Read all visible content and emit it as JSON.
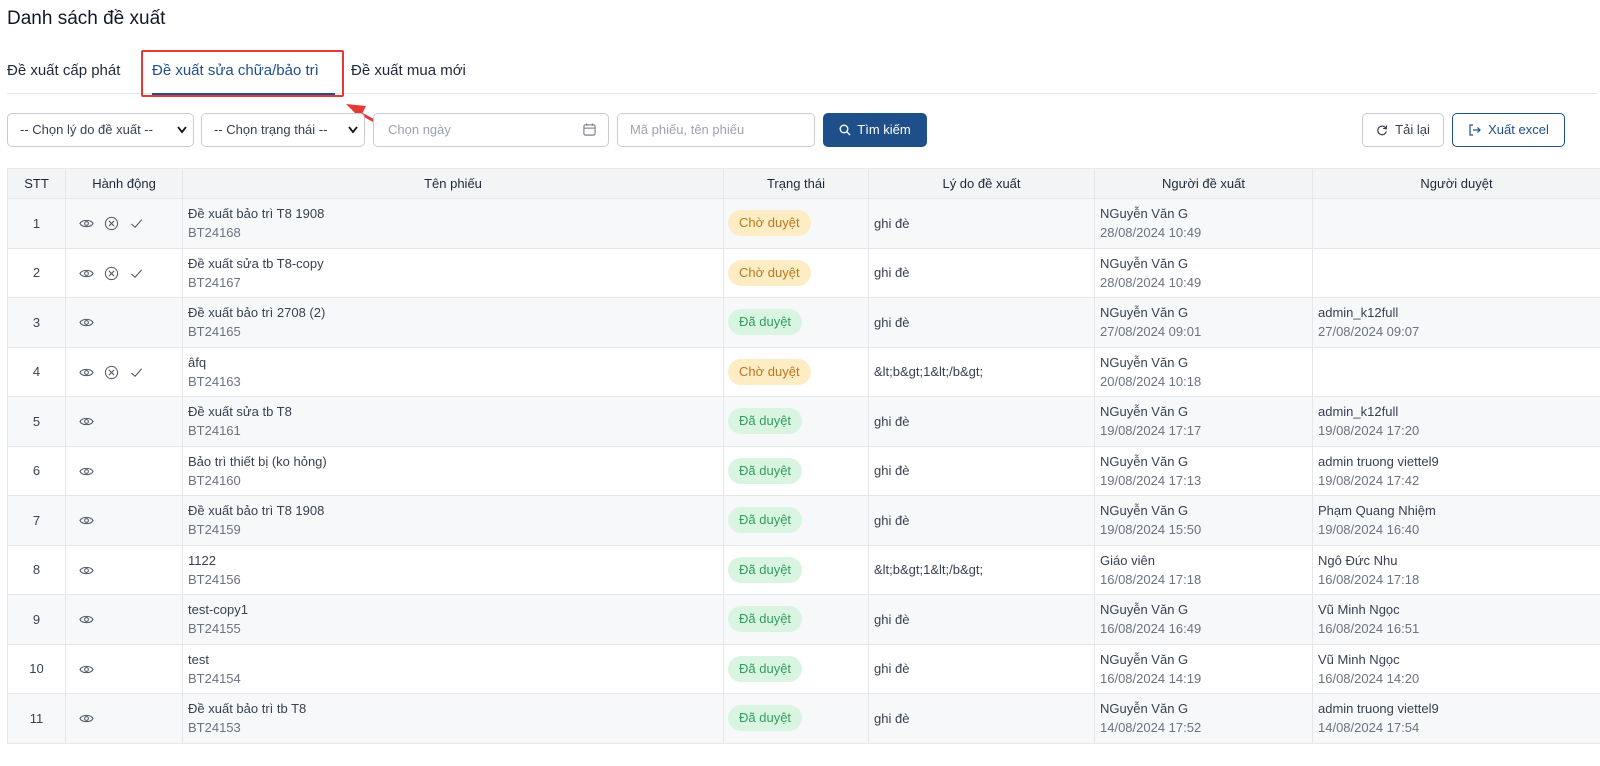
{
  "page": {
    "title": "Danh sách đề xuất"
  },
  "tabs": [
    {
      "label": "Đề xuất cấp phát"
    },
    {
      "label": "Đề xuất sửa chữa/bảo trì"
    },
    {
      "label": "Đề xuất mua mới"
    }
  ],
  "active_tab": "Đề xuất sửa chữa/bảo trì",
  "filters": {
    "reason_select": "-- Chọn lý do đề xuất --",
    "status_select": "-- Chọn trạng thái --",
    "date_placeholder": "Chọn ngày",
    "search_placeholder": "Mã phiếu, tên phiếu",
    "search_button": "Tìm kiếm",
    "reload_button": "Tải lại",
    "export_button": "Xuất excel"
  },
  "table": {
    "headers": [
      "STT",
      "Hành động",
      "Tên phiếu",
      "Trạng thái",
      "Lý do đề xuất",
      "Người đề xuất",
      "Người duyệt"
    ],
    "rows": [
      {
        "stt": "1",
        "name": "Đề xuất bảo trì T8 1908",
        "code": "BT24168",
        "status": "Chờ duyệt",
        "reason": "ghi đè",
        "proposer": "NGuyễn Văn G",
        "proposed_at": "28/08/2024 10:49",
        "approver": "",
        "approved_at": ""
      },
      {
        "stt": "2",
        "name": "Đề xuất sửa tb T8-copy",
        "code": "BT24167",
        "status": "Chờ duyệt",
        "reason": "ghi đè",
        "proposer": "NGuyễn Văn G",
        "proposed_at": "28/08/2024 10:49",
        "approver": "",
        "approved_at": ""
      },
      {
        "stt": "3",
        "name": "Đề xuất bảo trì 2708 (2)",
        "code": "BT24165",
        "status": "Đã duyệt",
        "reason": "ghi đè",
        "proposer": "NGuyễn Văn G",
        "proposed_at": "27/08/2024 09:01",
        "approver": "admin_k12full",
        "approved_at": "27/08/2024 09:07"
      },
      {
        "stt": "4",
        "name": "âfq",
        "code": "BT24163",
        "status": "Chờ duyệt",
        "reason": "&lt;b&gt;1&lt;/b&gt;",
        "proposer": "NGuyễn Văn G",
        "proposed_at": "20/08/2024 10:18",
        "approver": "",
        "approved_at": ""
      },
      {
        "stt": "5",
        "name": "Đề xuất sửa tb T8",
        "code": "BT24161",
        "status": "Đã duyệt",
        "reason": "ghi đè",
        "proposer": "NGuyễn Văn G",
        "proposed_at": "19/08/2024 17:17",
        "approver": "admin_k12full",
        "approved_at": "19/08/2024 17:20"
      },
      {
        "stt": "6",
        "name": "Bảo trì thiết bị (ko hỏng)",
        "code": "BT24160",
        "status": "Đã duyệt",
        "reason": "ghi đè",
        "proposer": "NGuyễn Văn G",
        "proposed_at": "19/08/2024 17:13",
        "approver": "admin truong viettel9",
        "approved_at": "19/08/2024 17:42"
      },
      {
        "stt": "7",
        "name": "Đề xuất bảo trì T8 1908",
        "code": "BT24159",
        "status": "Đã duyệt",
        "reason": "ghi đè",
        "proposer": "NGuyễn Văn G",
        "proposed_at": "19/08/2024 15:50",
        "approver": "Phạm Quang Nhiệm",
        "approved_at": "19/08/2024 16:40"
      },
      {
        "stt": "8",
        "name": "1122",
        "code": "BT24156",
        "status": "Đã duyệt",
        "reason": "&lt;b&gt;1&lt;/b&gt;",
        "proposer": "Giáo viên",
        "proposed_at": "16/08/2024 17:18",
        "approver": "Ngô Đức Nhu",
        "approved_at": "16/08/2024 17:18"
      },
      {
        "stt": "9",
        "name": "test-copy1",
        "code": "BT24155",
        "status": "Đã duyệt",
        "reason": "ghi đè",
        "proposer": "NGuyễn Văn G",
        "proposed_at": "16/08/2024 16:49",
        "approver": "Vũ Minh Ngọc",
        "approved_at": "16/08/2024 16:51"
      },
      {
        "stt": "10",
        "name": "test",
        "code": "BT24154",
        "status": "Đã duyệt",
        "reason": "ghi đè",
        "proposer": "NGuyễn Văn G",
        "proposed_at": "16/08/2024 14:19",
        "approver": "Vũ Minh Ngọc",
        "approved_at": "16/08/2024 14:20"
      },
      {
        "stt": "11",
        "name": "Đề xuất bảo trì tb T8",
        "code": "BT24153",
        "status": "Đã duyệt",
        "reason": "ghi đè",
        "proposer": "NGuyễn Văn G",
        "proposed_at": "14/08/2024 17:52",
        "approver": "admin truong viettel9",
        "approved_at": "14/08/2024 17:54"
      }
    ]
  },
  "colors": {
    "primary": "#1e4f8a",
    "highlight": "#e53935",
    "pending_bg": "#fdecc4",
    "pending_text": "#b7791f",
    "approved_bg": "#d9f5e1",
    "approved_text": "#2f9e5b"
  },
  "icons": [
    "eye-icon",
    "cancel-icon",
    "check-icon",
    "calendar-icon",
    "search-icon",
    "refresh-icon",
    "export-icon",
    "chevron-down-icon"
  ]
}
